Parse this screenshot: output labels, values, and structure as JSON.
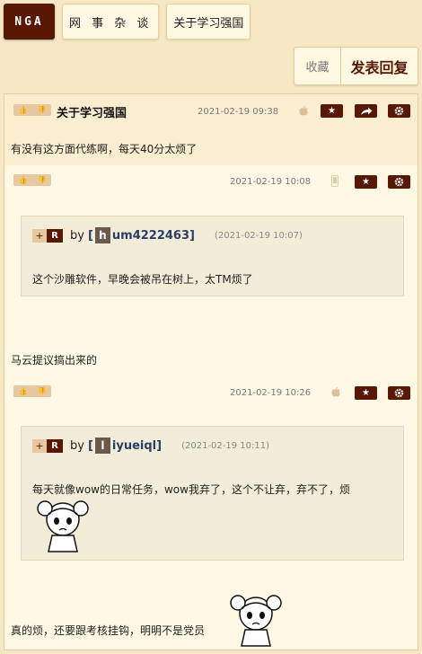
{
  "nav": {
    "logo": "NGA",
    "forum": "网 事 杂 谈",
    "thread": "关于学习强国"
  },
  "actions": {
    "favorite": "收藏",
    "reply": "发表回复"
  },
  "posts": [
    {
      "title": "关于学习强国",
      "date": "2021-02-19 09:38",
      "device_icon": "apple-icon",
      "text": "有没有这方面代练啊，每天40分太烦了"
    },
    {
      "date": "2021-02-19 10:08",
      "device_icon": "phone-icon",
      "quote": {
        "user_letter": "h",
        "user": "um4222463",
        "date": "(2021-02-19 10:07)",
        "text": "这个沙雕软件，早晚会被吊在树上，太TM烦了"
      },
      "text": "马云提议搞出来的"
    },
    {
      "date": "2021-02-19 10:26",
      "device_icon": "apple-icon",
      "quote": {
        "user_letter": "l",
        "user": "iyueiql",
        "date": "(2021-02-19 10:11)",
        "text": "每天就像wow的日常任务，wow我弃了，这个不让弃，弃不了，烦"
      },
      "text": "真的烦，还要跟考核挂钩，明明不是党员"
    }
  ],
  "quote_labels": {
    "by": "by",
    "open": "[",
    "close": "]"
  },
  "colors": {
    "accent": "#591804",
    "page_bg": "#f6e8c4",
    "post_bg": "#fff8e5",
    "quote_bg": "#f3ecd9",
    "user": "#2b3d66"
  }
}
